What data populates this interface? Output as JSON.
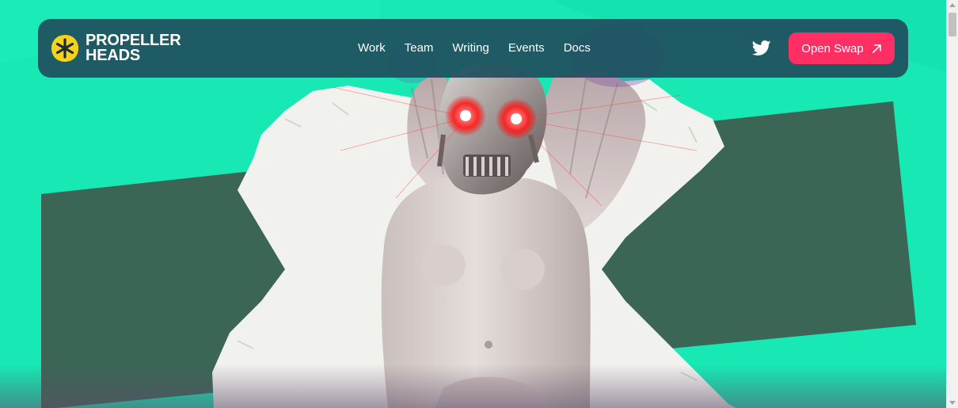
{
  "brand": {
    "line1": "PROPELLER",
    "line2": "HEADS",
    "logo_icon": "asterisk-badge-icon",
    "logo_color": "#f6d21a"
  },
  "nav": {
    "items": [
      {
        "label": "Work"
      },
      {
        "label": "Team"
      },
      {
        "label": "Writing"
      },
      {
        "label": "Events"
      },
      {
        "label": "Docs"
      }
    ]
  },
  "social": {
    "twitter_icon": "twitter-icon"
  },
  "cta": {
    "label": "Open Swap",
    "icon": "arrow-up-right-icon",
    "color": "#ff2f63"
  },
  "theme": {
    "background": "#17e8b4",
    "navbar": "#1f505f",
    "panel": "#3f6a5a"
  },
  "hero": {
    "image": "collage-statue-skull-glowing-red-eyes"
  }
}
